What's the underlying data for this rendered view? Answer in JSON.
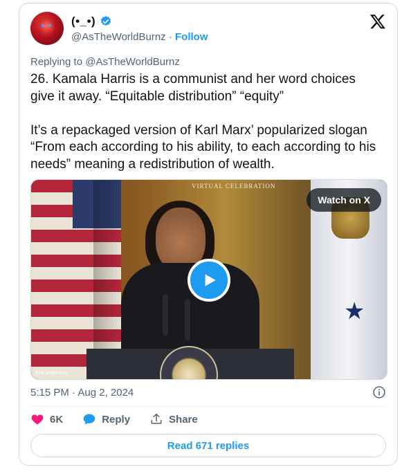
{
  "author": {
    "display_name": "(•_•)",
    "handle": "@AsTheWorldBurnz",
    "separator": " · ",
    "follow_label": "Follow"
  },
  "tweet": {
    "replying_prefix": "Replying to ",
    "replying_handle": "@AsTheWorldBurnz",
    "text": "26. Kamala Harris is a communist and her word choices give it away. “Equitable distribution” “equity”\n\nIt’s a repackaged version of Karl Marx’ popularized slogan “From each according to his ability, to each according to his needs” meaning a redistribution of wealth.",
    "timestamp": "5:15 PM · Aug 2, 2024"
  },
  "video": {
    "banner_text": "VIRTUAL CELEBRATION",
    "watermark": "End Wokeness",
    "watch_label": "Watch on X"
  },
  "actions": {
    "like_count": "6K",
    "reply_label": "Reply",
    "share_label": "Share"
  },
  "footer": {
    "read_replies_label": "Read 671 replies"
  },
  "colors": {
    "accent": "#1d9bf0",
    "like": "#f91880",
    "muted": "#536471"
  },
  "icons": [
    "verified-badge-icon",
    "x-logo-icon",
    "play-icon",
    "info-icon",
    "heart-icon",
    "reply-bubble-icon",
    "share-icon"
  ]
}
